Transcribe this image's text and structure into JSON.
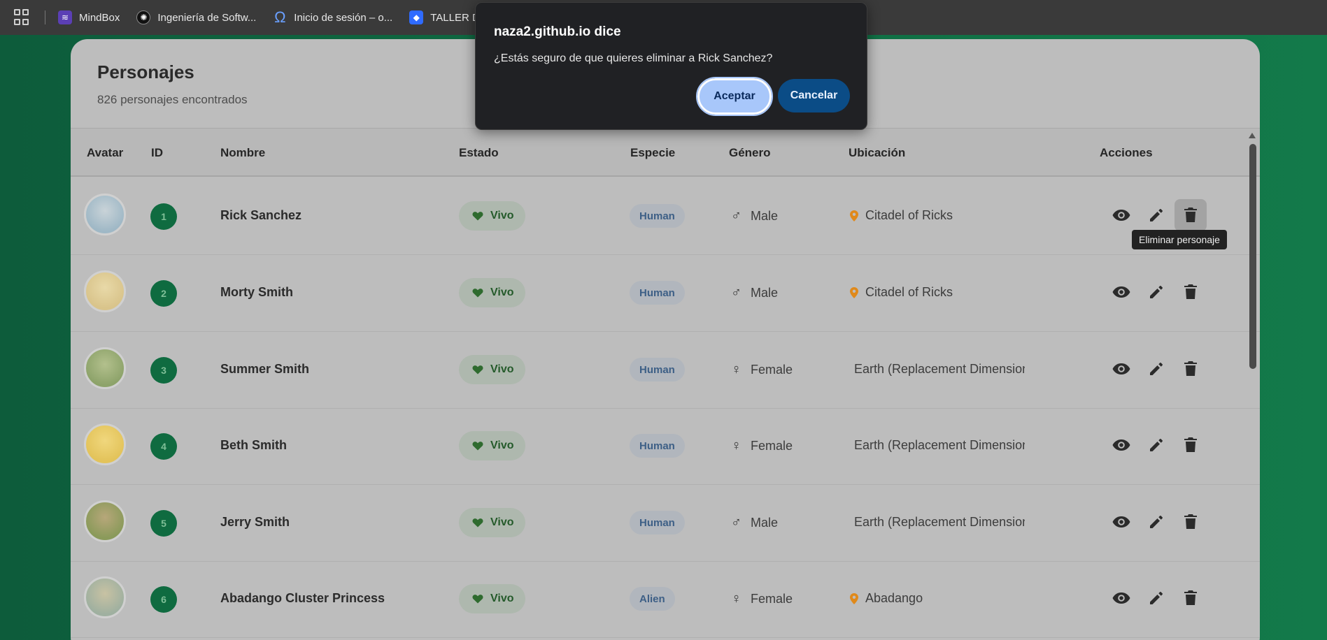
{
  "bookmarks": [
    {
      "label": "MindBox",
      "icon": "mindbox-icon"
    },
    {
      "label": "Ingeniería de Softw...",
      "icon": "ingenieria-icon"
    },
    {
      "label": "Inicio de sesión – o...",
      "icon": "omega-icon"
    },
    {
      "label": "TALLER DE IN",
      "icon": "dropbox-icon"
    }
  ],
  "card": {
    "title": "Personajes",
    "subtitle": "826 personajes encontrados"
  },
  "table": {
    "headers": [
      "Avatar",
      "ID",
      "Nombre",
      "Estado",
      "Especie",
      "Género",
      "Ubicación",
      "Acciones"
    ],
    "rows": [
      {
        "id": "1",
        "name": "Rick Sanchez",
        "status": "Vivo",
        "species": "Human",
        "gender": "Male",
        "gender_icon": "male-icon",
        "location": "Citadel of Ricks",
        "pin": true
      },
      {
        "id": "2",
        "name": "Morty Smith",
        "status": "Vivo",
        "species": "Human",
        "gender": "Male",
        "gender_icon": "male-icon",
        "location": "Citadel of Ricks",
        "pin": true
      },
      {
        "id": "3",
        "name": "Summer Smith",
        "status": "Vivo",
        "species": "Human",
        "gender": "Female",
        "gender_icon": "female-icon",
        "location": "Earth (Replacement Dimension)",
        "pin": false
      },
      {
        "id": "4",
        "name": "Beth Smith",
        "status": "Vivo",
        "species": "Human",
        "gender": "Female",
        "gender_icon": "female-icon",
        "location": "Earth (Replacement Dimension)",
        "pin": false
      },
      {
        "id": "5",
        "name": "Jerry Smith",
        "status": "Vivo",
        "species": "Human",
        "gender": "Male",
        "gender_icon": "male-icon",
        "location": "Earth (Replacement Dimension)",
        "pin": false
      },
      {
        "id": "6",
        "name": "Abadango Cluster Princess",
        "status": "Vivo",
        "species": "Alien",
        "gender": "Female",
        "gender_icon": "female-icon",
        "location": "Abadango",
        "pin": true
      }
    ]
  },
  "tooltip": "Eliminar personaje",
  "dialog": {
    "title": "naza2.github.io dice",
    "message": "¿Estás seguro de que quieres eliminar a Rick Sanchez?",
    "ok_label": "Aceptar",
    "cancel_label": "Cancelar"
  },
  "colors": {
    "accent_green": "#0f6b40",
    "dialog_bg": "#202124",
    "ok_button": "#a8c7fa",
    "cancel_button": "#0b4c86",
    "pin_orange": "#e0891a"
  }
}
